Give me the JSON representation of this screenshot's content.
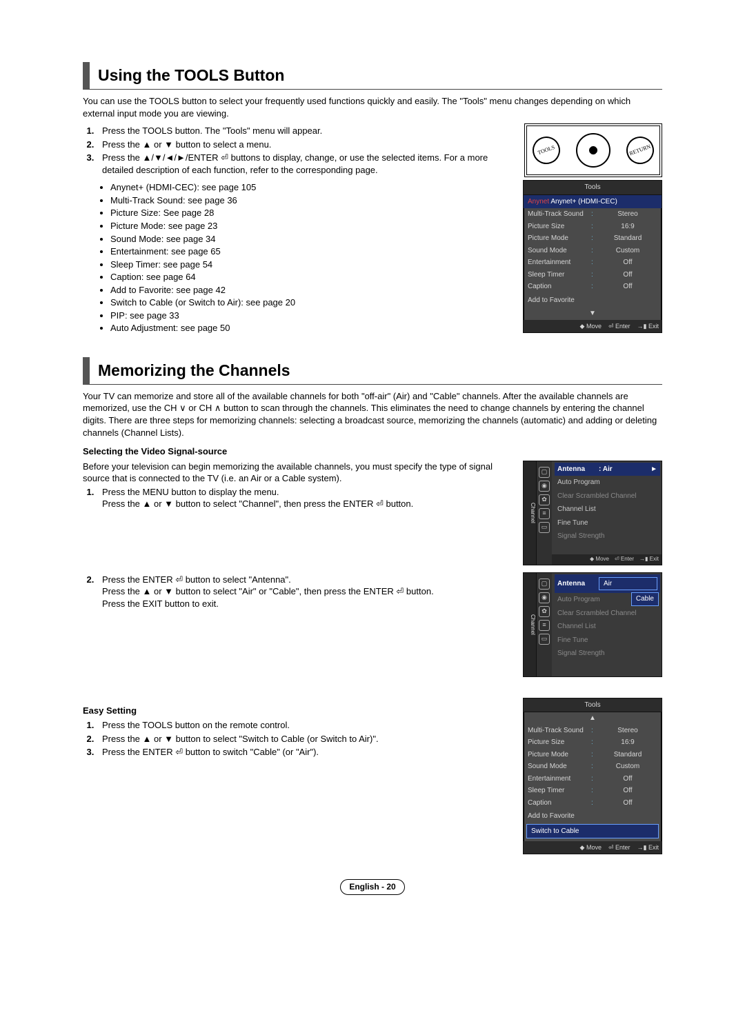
{
  "section1": {
    "title": "Using the TOOLS Button",
    "intro": "You can use the TOOLS button to select your frequently used functions quickly and easily. The \"Tools\" menu changes depending on which external input mode you are viewing.",
    "steps": [
      "Press the TOOLS button. The \"Tools\" menu will appear.",
      "Press the ▲ or ▼ button to select a menu.",
      "Press the ▲/▼/◄/►/ENTER ⏎ buttons to display, change, or use the selected items. For a more detailed description of each function, refer to the corresponding page."
    ],
    "bullets": [
      "Anynet+ (HDMI-CEC): see page 105",
      "Multi-Track Sound: see page 36",
      "Picture Size: See page 28",
      "Picture Mode: see page 23",
      "Sound Mode: see page 34",
      "Entertainment: see page 65",
      "Sleep Timer: see page 54",
      "Caption: see page 64",
      "Add to Favorite: see page 42",
      "Switch to Cable (or Switch to Air): see page 20",
      "PIP: see page 33",
      "Auto Adjustment: see page 50"
    ]
  },
  "tools_osd1": {
    "title": "Tools",
    "highlight": "Anynet+ (HDMI-CEC)",
    "rows": [
      {
        "lbl": "Multi-Track Sound",
        "val": "Stereo"
      },
      {
        "lbl": "Picture Size",
        "val": "16:9"
      },
      {
        "lbl": "Picture Mode",
        "val": "Standard"
      },
      {
        "lbl": "Sound Mode",
        "val": "Custom"
      },
      {
        "lbl": "Entertainment",
        "val": "Off"
      },
      {
        "lbl": "Sleep Timer",
        "val": "Off"
      },
      {
        "lbl": "Caption",
        "val": "Off"
      }
    ],
    "single": "Add to Favorite",
    "foot": {
      "move": "Move",
      "enter": "Enter",
      "exit": "Exit"
    }
  },
  "remote": {
    "left": "TOOLS",
    "right": "RETURN"
  },
  "section2": {
    "title": "Memorizing the Channels",
    "intro": "Your TV can memorize and store all of the available channels for both \"off-air\" (Air) and \"Cable\" channels. After the available channels are memorized, use the CH ∨ or CH ∧ button to scan through the channels. This eliminates the need to change channels by entering the channel digits. There are three steps for memorizing channels: selecting a broadcast source, memorizing the channels (automatic) and adding or deleting channels (Channel Lists).",
    "sub1": "Selecting the Video Signal-source",
    "sub1_intro": "Before your television can begin memorizing the available channels, you must specify the type of signal source that is connected to the TV (i.e. an Air or a Cable system).",
    "sub1_step1a": "Press the MENU button to display the menu.",
    "sub1_step1b": "Press the ▲ or ▼ button to select \"Channel\", then press the ENTER ⏎ button.",
    "sub1_step2a": "Press the ENTER ⏎ button to select \"Antenna\".",
    "sub1_step2b": "Press the ▲ or ▼ button to select \"Air\" or \"Cable\", then press the ENTER ⏎ button.",
    "sub1_step2c": "Press the EXIT button to exit.",
    "sub2": "Easy Setting",
    "sub2_steps": [
      "Press the TOOLS button on the remote control.",
      "Press the ▲ or ▼ button to select \"Switch to Cable (or Switch to Air)\".",
      "Press the ENTER ⏎ button to switch \"Cable\" (or \"Air\")."
    ]
  },
  "chmenu1": {
    "tab": "Channel",
    "hl_label": "Antenna",
    "hl_value": ": Air",
    "items": [
      "Auto Program",
      "Clear Scrambled Channel",
      "Channel List",
      "Fine Tune",
      "Signal Strength"
    ],
    "foot": {
      "move": "Move",
      "enter": "Enter",
      "exit": "Exit"
    }
  },
  "chmenu2": {
    "tab": "Channel",
    "hl_label": "Antenna",
    "opt1": "Air",
    "opt2": "Cable",
    "items": [
      "Auto Program",
      "Clear Scrambled Channel",
      "Channel List",
      "Fine Tune",
      "Signal Strength"
    ]
  },
  "tools_osd2": {
    "title": "Tools",
    "rows": [
      {
        "lbl": "Multi-Track Sound",
        "val": "Stereo"
      },
      {
        "lbl": "Picture Size",
        "val": "16:9"
      },
      {
        "lbl": "Picture Mode",
        "val": "Standard"
      },
      {
        "lbl": "Sound Mode",
        "val": "Custom"
      },
      {
        "lbl": "Entertainment",
        "val": "Off"
      },
      {
        "lbl": "Sleep Timer",
        "val": "Off"
      },
      {
        "lbl": "Caption",
        "val": "Off"
      }
    ],
    "single1": "Add to Favorite",
    "highlight": "Switch to Cable",
    "foot": {
      "move": "Move",
      "enter": "Enter",
      "exit": "Exit"
    }
  },
  "footer": "English - 20"
}
